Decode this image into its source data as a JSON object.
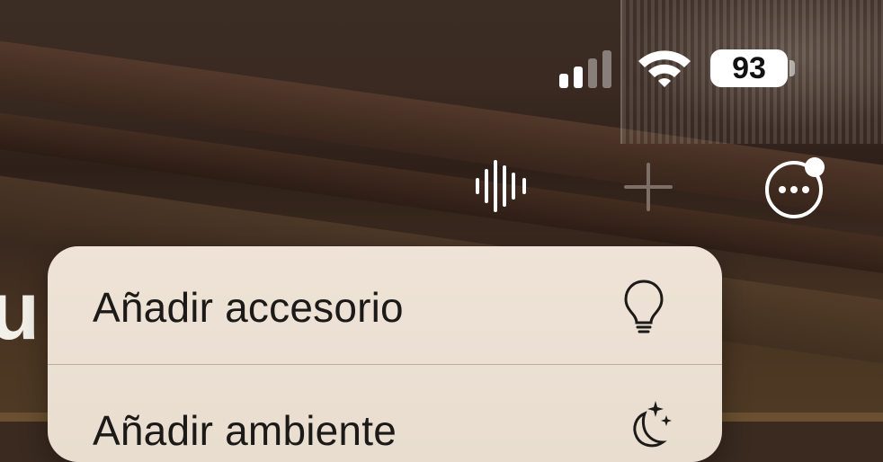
{
  "status_bar": {
    "battery_level": "93",
    "signal_bars_active": 2,
    "signal_bars_total": 4,
    "signal_icon": "cellular-signal-icon",
    "wifi_icon": "wifi-icon",
    "battery_icon": "battery-icon"
  },
  "toolbar": {
    "voice_icon": "waveform-icon",
    "add_icon": "plus-icon",
    "more_icon": "ellipsis-circle-icon",
    "more_has_badge": true
  },
  "page": {
    "title_fragment": "u"
  },
  "menu": {
    "items": [
      {
        "label": "Añadir accesorio",
        "icon": "lightbulb-icon"
      },
      {
        "label": "Añadir ambiente",
        "icon": "moon-stars-icon"
      }
    ]
  },
  "colors": {
    "menu_background": "#ece1d4",
    "menu_text": "#1c1a18",
    "icon_white": "#ffffff",
    "plus_dim": "#7d6f66"
  }
}
